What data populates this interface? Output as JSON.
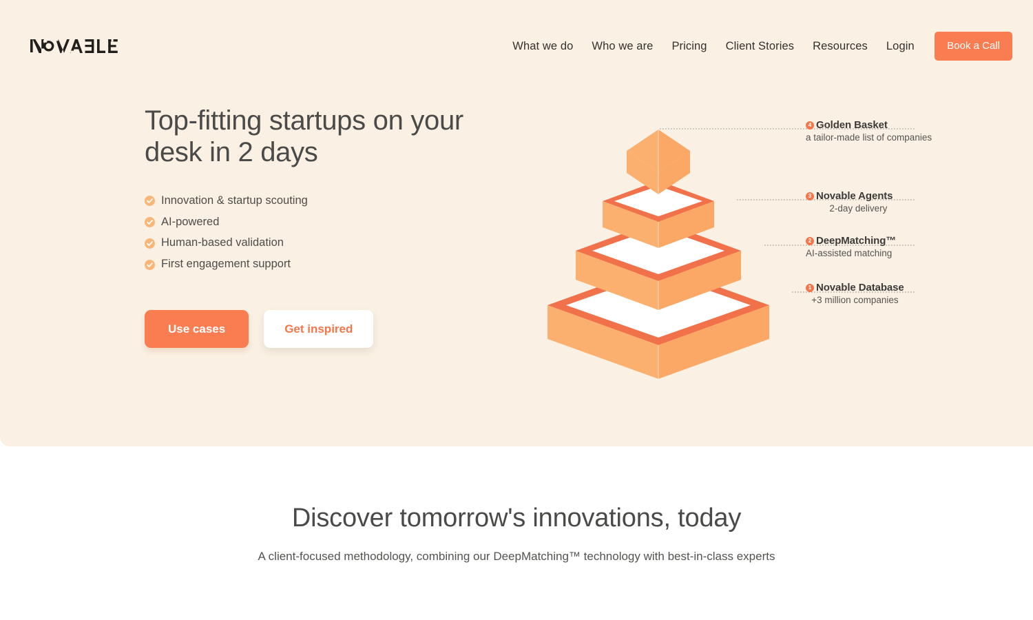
{
  "brand": {
    "logo_text": "NOVABLE",
    "accent_color": "#fa7d52",
    "accent_light_color": "#fbac6e",
    "hero_bg_color": "#faf1e4"
  },
  "header": {
    "nav_items": [
      {
        "label": "What we do"
      },
      {
        "label": "Who we are"
      },
      {
        "label": "Pricing"
      },
      {
        "label": "Client Stories"
      },
      {
        "label": "Resources"
      },
      {
        "label": "Login"
      }
    ],
    "cta_label": "Book a Call"
  },
  "hero": {
    "title": "Top-fitting startups on your desk in 2 days",
    "bullets": [
      {
        "icon": "check-circle-icon",
        "text": "Innovation & startup scouting"
      },
      {
        "icon": "check-circle-icon",
        "text": "AI-powered"
      },
      {
        "icon": "check-circle-icon",
        "text": "Human-based validation"
      },
      {
        "icon": "check-circle-icon",
        "text": "First engagement support"
      }
    ],
    "primary_cta": "Use cases",
    "secondary_cta": "Get inspired"
  },
  "pyramid": {
    "levels": [
      {
        "number": "4",
        "title": "Golden Basket",
        "subtitle": "a tailor-made list of companies"
      },
      {
        "number": "3",
        "title": "Novable Agents",
        "subtitle": "2-day delivery"
      },
      {
        "number": "2",
        "title": "DeepMatching™",
        "subtitle": "AI-assisted matching"
      },
      {
        "number": "1",
        "title": "Novable Database",
        "subtitle": "+3 million companies"
      }
    ]
  },
  "section2": {
    "title": "Discover tomorrow's innovations, today",
    "subtitle": "A client-focused methodology, combining our DeepMatching™ technology with best-in-class experts"
  }
}
